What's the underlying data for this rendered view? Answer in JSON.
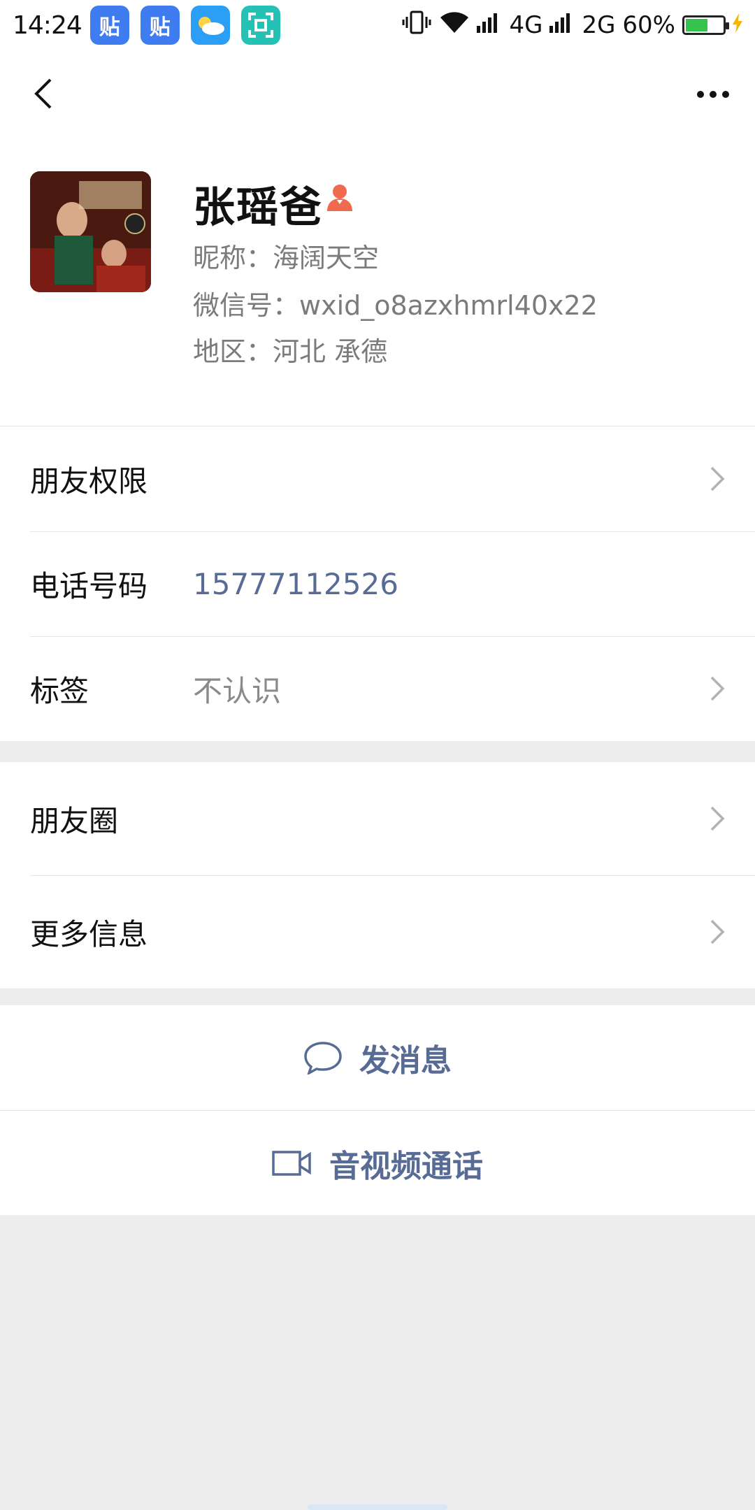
{
  "status_bar": {
    "time": "14:24",
    "network_4g": "4G",
    "network_2g": "2G",
    "battery_percent": "60%",
    "battery_level": 0.6,
    "app_icons": [
      "tieba-icon",
      "tieba-icon",
      "weather-icon",
      "scan-icon"
    ],
    "tieba_glyph": "贴"
  },
  "nav": {
    "back_icon": "chevron-left-icon",
    "more_icon": "more-dots-icon"
  },
  "profile": {
    "name": "张瑶爸",
    "gender_icon": "female-icon",
    "gender_color": "#f06a4e",
    "nickname": "昵称：海阔天空",
    "wechat_id": "微信号：wxid_o8azxhmrl40x22",
    "region": "地区：河北  承德"
  },
  "rows": {
    "friend_permissions": "朋友权限",
    "phone_label": "电话号码",
    "phone_value": "15777112526",
    "tag_label": "标签",
    "tag_value": "不认识",
    "moments": "朋友圈",
    "more_info": "更多信息"
  },
  "actions": {
    "send_message": "发消息",
    "video_call": "音视频通话"
  },
  "colors": {
    "link": "#576b95",
    "background": "#ededed"
  }
}
